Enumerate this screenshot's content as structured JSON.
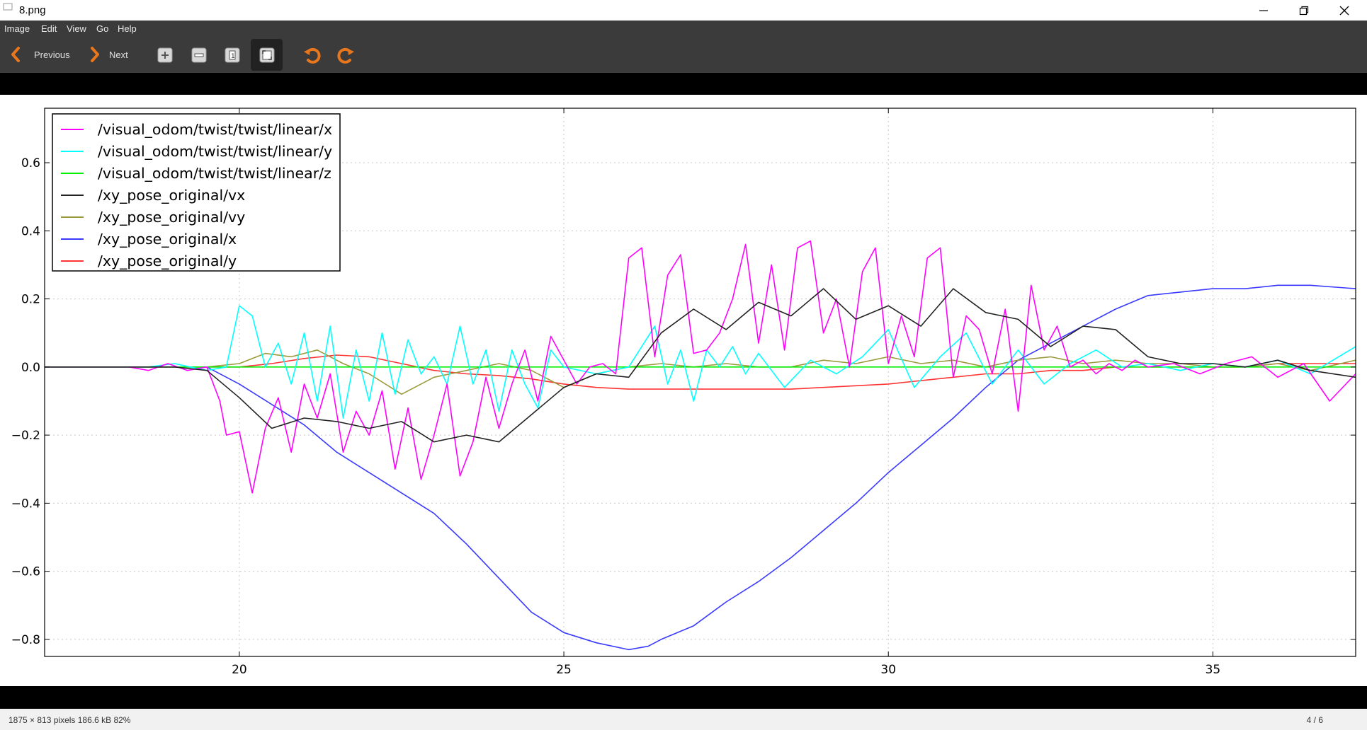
{
  "window": {
    "title": "8.png",
    "controls": [
      "minimize",
      "maximize",
      "close"
    ]
  },
  "menu": [
    "Image",
    "Edit",
    "View",
    "Go",
    "Help"
  ],
  "toolbar": {
    "previous_label": "Previous",
    "next_label": "Next",
    "icons": [
      "zoom-in-icon",
      "zoom-out-icon",
      "zoom-normal-icon",
      "best-fit-icon",
      "rotate-left-icon",
      "rotate-right-icon"
    ],
    "accent": "#e8761c"
  },
  "status": {
    "info": "1875 × 813 pixels  186.6 kB    82%",
    "page": "4 / 6"
  },
  "chart_data": {
    "type": "line",
    "xlim": [
      17,
      37.2
    ],
    "ylim": [
      -0.85,
      0.76
    ],
    "xticks": [
      20,
      25,
      30,
      35
    ],
    "yticks": [
      0.6,
      0.4,
      0.2,
      0.0,
      -0.2,
      -0.4,
      -0.6,
      -0.8
    ],
    "yticklabels": [
      "0.6",
      "0.4",
      "0.2",
      "0.0",
      "−0.2",
      "−0.4",
      "−0.6",
      "−0.8"
    ],
    "grid": true,
    "legend_position": "top-left",
    "series": [
      {
        "name": "/visual_odom/twist/twist/linear/x",
        "color": "#ff00ff",
        "x": [
          17,
          18.3,
          18.6,
          18.9,
          19.2,
          19.5,
          19.7,
          19.8,
          20.0,
          20.2,
          20.4,
          20.6,
          20.8,
          21.0,
          21.2,
          21.4,
          21.6,
          21.8,
          22.0,
          22.2,
          22.4,
          22.6,
          22.8,
          23.0,
          23.2,
          23.4,
          23.6,
          23.8,
          24.0,
          24.2,
          24.4,
          24.6,
          24.8,
          25.0,
          25.2,
          25.4,
          25.6,
          25.8,
          26.0,
          26.2,
          26.4,
          26.6,
          26.8,
          27.0,
          27.2,
          27.4,
          27.6,
          27.8,
          28.0,
          28.2,
          28.4,
          28.6,
          28.8,
          29.0,
          29.2,
          29.4,
          29.6,
          29.8,
          30.0,
          30.2,
          30.4,
          30.6,
          30.8,
          31.0,
          31.2,
          31.4,
          31.6,
          31.8,
          32.0,
          32.2,
          32.4,
          32.6,
          32.8,
          33.0,
          33.2,
          33.4,
          33.6,
          33.8,
          34.0,
          34.4,
          34.8,
          35.2,
          35.6,
          36.0,
          36.4,
          36.8,
          37.2
        ],
        "y": [
          0.0,
          0.0,
          -0.01,
          0.01,
          -0.01,
          0.0,
          -0.1,
          -0.2,
          -0.19,
          -0.37,
          -0.18,
          -0.09,
          -0.25,
          -0.05,
          -0.15,
          -0.02,
          -0.25,
          -0.13,
          -0.2,
          -0.07,
          -0.3,
          -0.12,
          -0.33,
          -0.2,
          -0.05,
          -0.32,
          -0.22,
          -0.03,
          -0.18,
          -0.05,
          0.05,
          -0.1,
          0.09,
          0.02,
          -0.05,
          0.0,
          0.01,
          -0.02,
          0.32,
          0.35,
          0.03,
          0.27,
          0.33,
          0.04,
          0.05,
          0.1,
          0.2,
          0.36,
          0.07,
          0.3,
          0.05,
          0.35,
          0.37,
          0.1,
          0.2,
          0.0,
          0.28,
          0.35,
          0.01,
          0.15,
          0.03,
          0.32,
          0.35,
          -0.03,
          0.15,
          0.11,
          -0.02,
          0.17,
          -0.13,
          0.24,
          0.05,
          0.12,
          0.0,
          0.02,
          -0.02,
          0.01,
          -0.01,
          0.02,
          0.0,
          0.01,
          -0.02,
          0.01,
          0.03,
          -0.03,
          0.01,
          -0.1,
          -0.02
        ]
      },
      {
        "name": "/visual_odom/twist/twist/linear/y",
        "color": "#00ffff",
        "x": [
          17,
          18.6,
          19.0,
          19.5,
          19.8,
          20.0,
          20.2,
          20.4,
          20.6,
          20.8,
          21.0,
          21.2,
          21.4,
          21.6,
          21.8,
          22.0,
          22.2,
          22.4,
          22.6,
          22.8,
          23.0,
          23.2,
          23.4,
          23.6,
          23.8,
          24.0,
          24.2,
          24.4,
          24.6,
          24.8,
          25.0,
          25.5,
          26.0,
          26.4,
          26.6,
          26.8,
          27.0,
          27.2,
          27.4,
          27.6,
          27.8,
          28.0,
          28.4,
          28.8,
          29.2,
          29.6,
          30.0,
          30.4,
          30.8,
          31.2,
          31.6,
          32.0,
          32.4,
          32.8,
          33.2,
          33.6,
          34.0,
          34.5,
          35.0,
          35.5,
          36.0,
          36.5,
          37.2
        ],
        "y": [
          0.0,
          0.0,
          0.01,
          -0.01,
          0.0,
          0.18,
          0.15,
          0.0,
          0.07,
          -0.05,
          0.1,
          -0.1,
          0.12,
          -0.15,
          0.05,
          -0.1,
          0.1,
          -0.08,
          0.08,
          -0.02,
          0.03,
          -0.05,
          0.12,
          -0.05,
          0.05,
          -0.13,
          0.05,
          -0.05,
          -0.12,
          0.05,
          0.0,
          -0.02,
          0.0,
          0.12,
          -0.05,
          0.05,
          -0.1,
          0.05,
          0.0,
          0.06,
          -0.02,
          0.04,
          -0.06,
          0.02,
          -0.02,
          0.03,
          0.11,
          -0.06,
          0.03,
          0.1,
          -0.05,
          0.05,
          -0.05,
          0.01,
          0.05,
          0.0,
          0.01,
          -0.01,
          0.01,
          0.0,
          0.02,
          -0.02,
          0.06
        ]
      },
      {
        "name": "/visual_odom/twist/twist/linear/z",
        "color": "#00ee00",
        "x": [
          17,
          37.2
        ],
        "y": [
          0.0,
          0.0
        ]
      },
      {
        "name": "/xy_pose_original/vx",
        "color": "#222222",
        "x": [
          17,
          19.0,
          19.5,
          20.0,
          20.5,
          21.0,
          21.5,
          22.0,
          22.5,
          23.0,
          23.5,
          24.0,
          24.5,
          25.0,
          25.5,
          26.0,
          26.5,
          27.0,
          27.5,
          28.0,
          28.5,
          29.0,
          29.5,
          30.0,
          30.5,
          31.0,
          31.5,
          32.0,
          32.5,
          33.0,
          33.5,
          34.0,
          34.5,
          35.0,
          35.5,
          36.0,
          36.5,
          37.2
        ],
        "y": [
          0.0,
          0.0,
          -0.01,
          -0.09,
          -0.18,
          -0.15,
          -0.16,
          -0.18,
          -0.16,
          -0.22,
          -0.2,
          -0.22,
          -0.14,
          -0.06,
          -0.02,
          -0.03,
          0.1,
          0.17,
          0.11,
          0.19,
          0.15,
          0.23,
          0.14,
          0.18,
          0.12,
          0.23,
          0.16,
          0.14,
          0.06,
          0.12,
          0.11,
          0.03,
          0.01,
          0.01,
          0.0,
          0.02,
          -0.01,
          -0.03
        ]
      },
      {
        "name": "/xy_pose_original/vy",
        "color": "#9a9a3c",
        "x": [
          17,
          19.5,
          20.0,
          20.4,
          20.8,
          21.2,
          21.6,
          22.0,
          22.5,
          23.0,
          23.5,
          24.0,
          24.5,
          25.0,
          25.5,
          26.0,
          26.5,
          27.0,
          27.5,
          28.0,
          28.5,
          29.0,
          29.5,
          30.0,
          30.5,
          31.0,
          31.5,
          32.0,
          32.5,
          33.0,
          33.5,
          34.0,
          34.5,
          35.0,
          35.5,
          36.0,
          36.5,
          37.2
        ],
        "y": [
          0.0,
          0.0,
          0.01,
          0.04,
          0.03,
          0.05,
          0.01,
          -0.02,
          -0.08,
          -0.03,
          -0.01,
          0.01,
          -0.01,
          -0.06,
          -0.02,
          0.0,
          0.01,
          0.0,
          0.01,
          0.0,
          0.0,
          0.02,
          0.01,
          0.03,
          0.01,
          0.02,
          0.0,
          0.02,
          0.03,
          0.01,
          0.02,
          0.01,
          0.01,
          0.0,
          0.0,
          0.01,
          -0.01,
          0.02
        ]
      },
      {
        "name": "/xy_pose_original/x",
        "color": "#3a3aff",
        "x": [
          17,
          19.5,
          20.0,
          20.5,
          21.0,
          21.5,
          22.0,
          22.5,
          23.0,
          23.5,
          24.0,
          24.5,
          25.0,
          25.5,
          26.0,
          26.3,
          26.5,
          27.0,
          27.5,
          28.0,
          28.5,
          29.0,
          29.5,
          30.0,
          30.5,
          31.0,
          31.5,
          32.0,
          32.5,
          33.0,
          33.5,
          34.0,
          34.5,
          35.0,
          35.5,
          36.0,
          36.5,
          37.2
        ],
        "y": [
          0.0,
          0.0,
          -0.05,
          -0.11,
          -0.17,
          -0.25,
          -0.31,
          -0.37,
          -0.43,
          -0.52,
          -0.62,
          -0.72,
          -0.78,
          -0.81,
          -0.83,
          -0.82,
          -0.8,
          -0.76,
          -0.69,
          -0.63,
          -0.56,
          -0.48,
          -0.4,
          -0.31,
          -0.23,
          -0.15,
          -0.06,
          0.02,
          0.07,
          0.12,
          0.17,
          0.21,
          0.22,
          0.23,
          0.23,
          0.24,
          0.24,
          0.23
        ]
      },
      {
        "name": "/xy_pose_original/y",
        "color": "#ff3333",
        "x": [
          17,
          19.5,
          20.0,
          20.5,
          21.0,
          21.5,
          22.0,
          22.5,
          23.0,
          23.5,
          24.0,
          24.5,
          25.0,
          25.5,
          26.0,
          26.5,
          27.0,
          27.5,
          28.0,
          28.5,
          29.0,
          29.5,
          30.0,
          30.5,
          31.0,
          31.5,
          32.0,
          32.5,
          33.0,
          33.5,
          34.0,
          34.5,
          35.0,
          35.5,
          36.0,
          36.5,
          37.2
        ],
        "y": [
          0.0,
          0.0,
          0.0,
          0.01,
          0.025,
          0.035,
          0.03,
          0.01,
          -0.01,
          -0.02,
          -0.025,
          -0.035,
          -0.05,
          -0.06,
          -0.065,
          -0.065,
          -0.065,
          -0.065,
          -0.065,
          -0.065,
          -0.06,
          -0.055,
          -0.05,
          -0.04,
          -0.03,
          -0.02,
          -0.02,
          -0.01,
          -0.01,
          0.0,
          0.0,
          0.0,
          0.0,
          0.0,
          0.01,
          0.01,
          0.01
        ]
      }
    ]
  }
}
